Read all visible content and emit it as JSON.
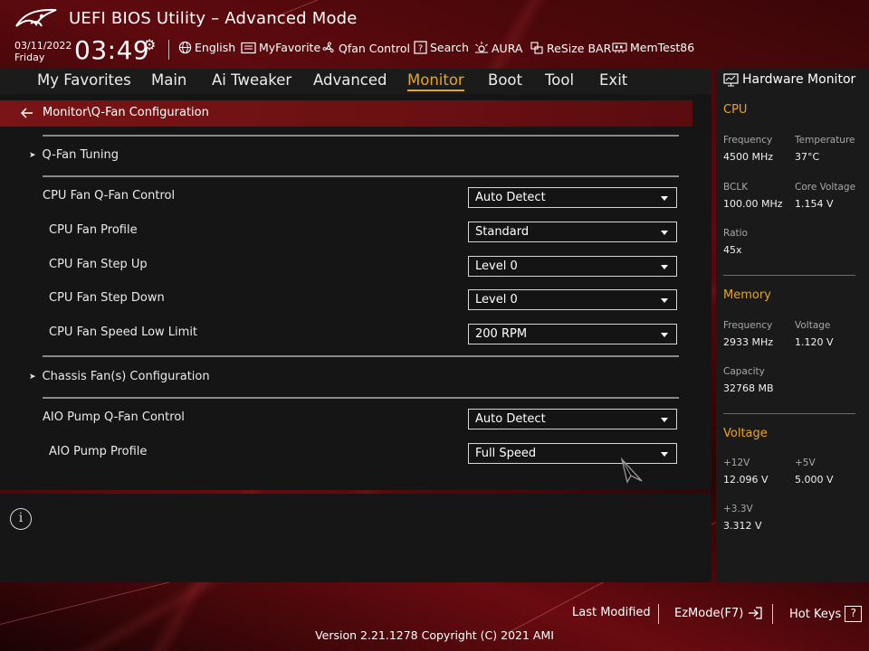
{
  "app": {
    "title": "UEFI BIOS Utility – Advanced Mode",
    "date": "03/11/2022",
    "day": "Friday",
    "time": "03:49"
  },
  "toolbar": [
    {
      "icon": "globe-icon",
      "label": "English"
    },
    {
      "icon": "myfavorite-icon",
      "label": "MyFavorite"
    },
    {
      "icon": "fan-icon",
      "label": "Qfan Control"
    },
    {
      "icon": "search-icon",
      "label": "Search"
    },
    {
      "icon": "aura-icon",
      "label": "AURA"
    },
    {
      "icon": "resize-bar-icon",
      "label": "ReSize BAR"
    },
    {
      "icon": "memtest-icon",
      "label": "MemTest86"
    }
  ],
  "nav": {
    "tabs": [
      "My Favorites",
      "Main",
      "Ai Tweaker",
      "Advanced",
      "Monitor",
      "Boot",
      "Tool",
      "Exit"
    ],
    "active": "Monitor"
  },
  "breadcrumb": "Monitor\\Q-Fan Configuration",
  "settings": {
    "qfan_tuning": "Q-Fan Tuning",
    "cpu_fan_control": {
      "label": "CPU Fan Q-Fan Control",
      "value": "Auto Detect"
    },
    "cpu_fan_profile": {
      "label": "CPU Fan Profile",
      "value": "Standard"
    },
    "cpu_fan_step_up": {
      "label": "CPU Fan Step Up",
      "value": "Level 0"
    },
    "cpu_fan_step_down": {
      "label": "CPU Fan Step Down",
      "value": "Level 0"
    },
    "cpu_fan_speed_low": {
      "label": "CPU Fan Speed Low Limit",
      "value": "200 RPM"
    },
    "chassis_fans": "Chassis Fan(s) Configuration",
    "aio_pump_control": {
      "label": "AIO Pump Q-Fan Control",
      "value": "Auto Detect"
    },
    "aio_pump_profile": {
      "label": "AIO Pump Profile",
      "value": "Full Speed"
    }
  },
  "info_icon": "i",
  "hardware_monitor": {
    "title": "Hardware Monitor",
    "cpu": {
      "heading": "CPU",
      "frequency_label": "Frequency",
      "frequency": "4500 MHz",
      "temperature_label": "Temperature",
      "temperature": "37°C",
      "bclk_label": "BCLK",
      "bclk": "100.00 MHz",
      "core_voltage_label": "Core Voltage",
      "core_voltage": "1.154 V",
      "ratio_label": "Ratio",
      "ratio": "45x"
    },
    "memory": {
      "heading": "Memory",
      "frequency_label": "Frequency",
      "frequency": "2933 MHz",
      "voltage_label": "Voltage",
      "voltage": "1.120 V",
      "capacity_label": "Capacity",
      "capacity": "32768 MB"
    },
    "voltage": {
      "heading": "Voltage",
      "v12_label": "+12V",
      "v12": "12.096 V",
      "v5_label": "+5V",
      "v5": "5.000 V",
      "v33_label": "+3.3V",
      "v33": "3.312 V"
    }
  },
  "footer": {
    "last_modified": "Last Modified",
    "ezmode": "EzMode(F7)",
    "hot_keys": "Hot Keys",
    "hot_keys_key": "?",
    "version": "Version 2.21.1278 Copyright (C) 2021 AMI"
  },
  "colors": {
    "accent": "#e8a520",
    "breadcrumb_bg": "#7a1416",
    "panel_bg": "#151515"
  }
}
